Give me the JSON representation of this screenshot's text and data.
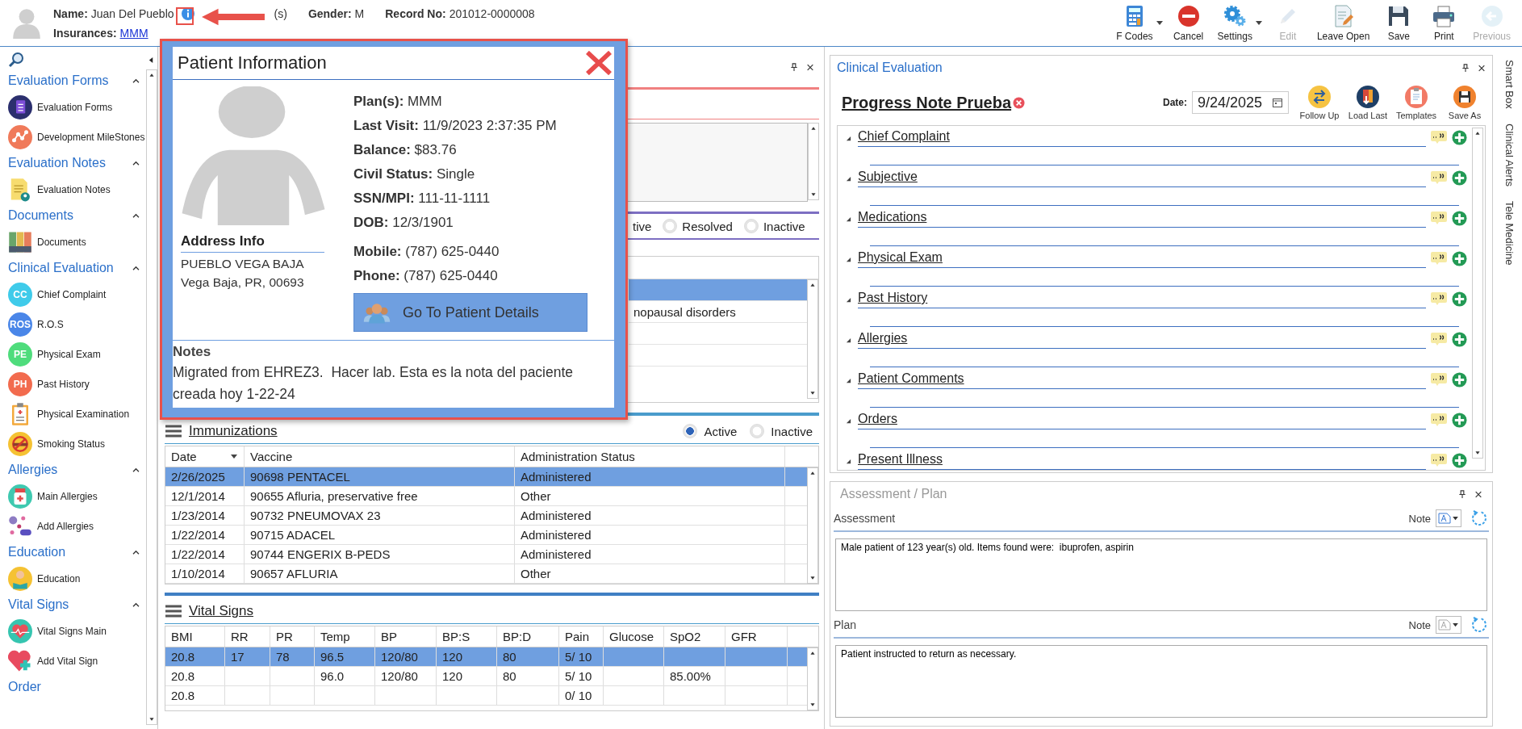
{
  "header": {
    "name_label": "Name:",
    "name": "Juan Del Pueblo",
    "age_fragment": "(s)",
    "gender_label": "Gender:",
    "gender": "M",
    "record_label": "Record No:",
    "record": "201012-0000008",
    "insurances_label": "Insurances:",
    "insurance": "MMM"
  },
  "toolbar": [
    {
      "label": "F Codes",
      "kind": "fcodes",
      "dropdown": true,
      "disabled": false
    },
    {
      "label": "Cancel",
      "kind": "cancel",
      "dropdown": false,
      "disabled": false
    },
    {
      "label": "Settings",
      "kind": "settings",
      "dropdown": true,
      "disabled": false
    },
    {
      "label": "Edit",
      "kind": "edit",
      "dropdown": false,
      "disabled": true
    },
    {
      "label": "Leave Open",
      "kind": "leave",
      "dropdown": false,
      "disabled": false
    },
    {
      "label": "Save",
      "kind": "save",
      "dropdown": false,
      "disabled": false
    },
    {
      "label": "Print",
      "kind": "print",
      "dropdown": false,
      "disabled": false
    },
    {
      "label": "Previous",
      "kind": "previous",
      "dropdown": false,
      "disabled": true
    }
  ],
  "sidebar": {
    "sections": [
      {
        "title": "Evaluation Forms",
        "expanded": true,
        "items": [
          {
            "label": "Evaluation Forms",
            "kind": "form"
          },
          {
            "label": "Development MileStones",
            "kind": "milestones"
          }
        ]
      },
      {
        "title": "Evaluation Notes",
        "expanded": true,
        "items": [
          {
            "label": "Evaluation Notes",
            "kind": "notes"
          }
        ]
      },
      {
        "title": "Documents",
        "expanded": true,
        "items": [
          {
            "label": "Documents",
            "kind": "documents"
          }
        ]
      },
      {
        "title": "Clinical Evaluation",
        "expanded": true,
        "items": [
          {
            "label": "Chief Complaint",
            "kind": "badge",
            "badge": "CC",
            "color": "#3fcbea"
          },
          {
            "label": "R.O.S",
            "kind": "badge",
            "badge": "ROS",
            "color": "#4a86e8"
          },
          {
            "label": "Physical Exam",
            "kind": "badge",
            "badge": "PE",
            "color": "#4fdc7c"
          },
          {
            "label": "Past History",
            "kind": "badge",
            "badge": "PH",
            "color": "#f26b4e"
          },
          {
            "label": "Physical Examination",
            "kind": "exam"
          },
          {
            "label": "Smoking Status",
            "kind": "smoking"
          }
        ]
      },
      {
        "title": "Allergies",
        "expanded": true,
        "items": [
          {
            "label": "Main Allergies",
            "kind": "allergy"
          },
          {
            "label": "Add Allergies",
            "kind": "pills"
          }
        ]
      },
      {
        "title": "Education",
        "expanded": true,
        "items": [
          {
            "label": "Education",
            "kind": "education"
          }
        ]
      },
      {
        "title": "Vital Signs",
        "expanded": true,
        "items": [
          {
            "label": "Vital Signs Main",
            "kind": "vitals"
          },
          {
            "label": "Add Vital Sign",
            "kind": "addvital"
          }
        ]
      },
      {
        "title": "Order"
      }
    ]
  },
  "problems": {
    "filter_fragment": "tive",
    "filters": [
      {
        "label": "Resolved",
        "selected": false
      },
      {
        "label": "Inactive",
        "selected": false
      }
    ],
    "rows": [
      {
        "selected": true
      },
      {
        "text": "nopausal disorders",
        "selected": false
      },
      {
        "selected": false
      },
      {
        "selected": false
      }
    ]
  },
  "immunizations": {
    "title": "Immunizations",
    "filters": [
      {
        "label": "Active",
        "selected": true
      },
      {
        "label": "Inactive",
        "selected": false
      }
    ],
    "columns": [
      "Date",
      "Vaccine",
      "Administration Status"
    ],
    "rows": [
      {
        "cells": [
          "2/26/2025",
          "90698 PENTACEL",
          "Administered"
        ],
        "selected": true
      },
      {
        "cells": [
          "12/1/2014",
          "90655 Afluria, preservative free",
          "Other"
        ],
        "selected": false
      },
      {
        "cells": [
          "1/23/2014",
          "90732 PNEUMOVAX 23",
          "Administered"
        ],
        "selected": false
      },
      {
        "cells": [
          "1/22/2014",
          "90715 ADACEL",
          "Administered"
        ],
        "selected": false
      },
      {
        "cells": [
          "1/22/2014",
          "90744 ENGERIX B-PEDS",
          "Administered"
        ],
        "selected": false
      },
      {
        "cells": [
          "1/10/2014",
          "90657 AFLURIA",
          "Other"
        ],
        "selected": false
      }
    ]
  },
  "vital_signs": {
    "title": "Vital Signs",
    "columns": [
      "BMI",
      "RR",
      "PR",
      "Temp",
      "BP",
      "BP:S",
      "BP:D",
      "Pain",
      "Glucose",
      "SpO2",
      "GFR"
    ],
    "rows": [
      {
        "cells": [
          "20.8",
          "17",
          "78",
          "96.5",
          "120/80",
          "120",
          "80",
          "5/ 10",
          "",
          "",
          ""
        ],
        "selected": true
      },
      {
        "cells": [
          "20.8",
          "",
          "",
          "96.0",
          "120/80",
          "120",
          "80",
          "5/ 10",
          "",
          "85.00%",
          ""
        ],
        "selected": false
      },
      {
        "cells": [
          "20.8",
          "",
          "",
          "",
          "",
          "",
          "",
          "0/ 10",
          "",
          "",
          ""
        ],
        "selected": false
      }
    ]
  },
  "popup": {
    "title": "Patient Information",
    "fields": [
      {
        "label": "Plan(s):",
        "value": "MMM"
      },
      {
        "label": "Last Visit:",
        "value": "11/9/2023 2:37:35 PM"
      },
      {
        "label": "Balance:",
        "value": "$83.76"
      },
      {
        "label": "Civil Status:",
        "value": "Single"
      },
      {
        "label": "SSN/MPI:",
        "value": "111-11-1111"
      },
      {
        "label": "DOB:",
        "value": "12/3/1901"
      }
    ],
    "contacts": [
      {
        "label": "Mobile:",
        "value": "(787) 625-0440"
      },
      {
        "label": "Phone:",
        "value": "(787) 625-0440"
      }
    ],
    "address_title": "Address Info",
    "address_lines": [
      "PUEBLO VEGA BAJA",
      "Vega Baja, PR, 00693"
    ],
    "button": "Go To Patient Details",
    "notes_title": "Notes",
    "notes": "Migrated from EHREZ3.  Hacer lab. Esta es la nota del paciente creada hoy 1-22-24"
  },
  "clinical_evaluation": {
    "title": "Clinical Evaluation",
    "note_title": "Progress Note Prueba",
    "date_label": "Date:",
    "date": "9/24/2025",
    "actions": [
      {
        "label": "Follow Up",
        "kind": "follow"
      },
      {
        "label": "Load Last",
        "kind": "load"
      },
      {
        "label": "Templates",
        "kind": "templates"
      },
      {
        "label": "Save As",
        "kind": "saveas"
      }
    ],
    "sections": [
      {
        "title": "Chief Complaint",
        "expanded": true
      },
      {
        "title": "Subjective",
        "expanded": true
      },
      {
        "title": "Medications",
        "expanded": true
      },
      {
        "title": "Physical Exam",
        "expanded": true
      },
      {
        "title": "Past History",
        "expanded": true
      },
      {
        "title": "Allergies",
        "expanded": true
      },
      {
        "title": "Patient Comments",
        "expanded": true
      },
      {
        "title": "Orders",
        "expanded": true
      },
      {
        "title": "Present Illness",
        "expanded": true
      }
    ]
  },
  "side_tabs": [
    "Smart Box",
    "Clinical Alerts",
    "Tele Medicine"
  ],
  "assessment_plan": {
    "title": "Assessment / Plan",
    "fields": [
      {
        "label": "Assessment",
        "note_label": "Note",
        "format_enabled": true,
        "text": "Male patient of 123 year(s) old. Items found were:  ibuprofen, aspirin"
      },
      {
        "label": "Plan",
        "note_label": "Note",
        "format_enabled": false,
        "text": "Patient instructed to return as necessary."
      }
    ]
  }
}
